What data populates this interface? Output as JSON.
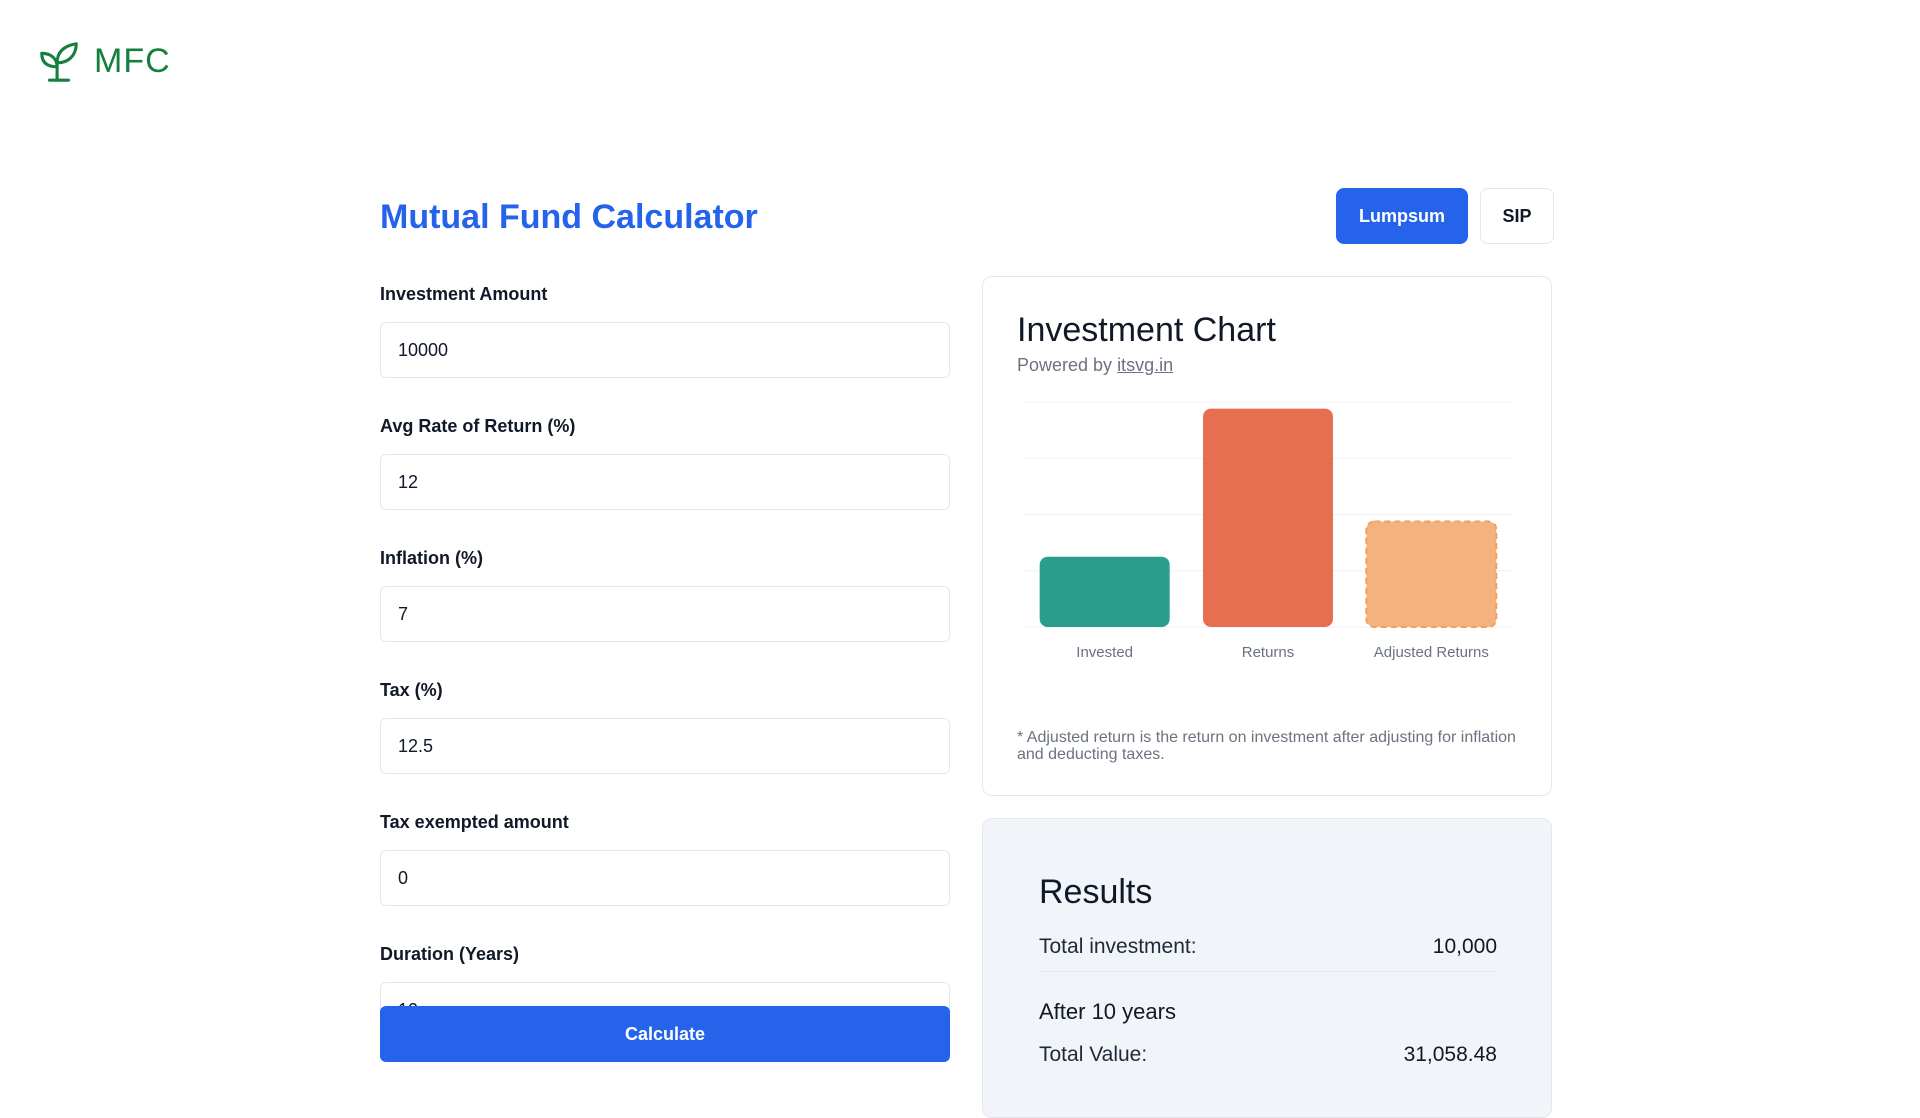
{
  "brand": {
    "logo_text": "MFC",
    "icon": "sprout-icon",
    "color": "#15803d"
  },
  "page": {
    "title": "Mutual Fund Calculator",
    "accent": "#2563eb"
  },
  "mode_toggle": {
    "active": "Lumpsum",
    "options": [
      "Lumpsum",
      "SIP"
    ]
  },
  "form": {
    "fields": [
      {
        "label": "Investment Amount",
        "value": "10000"
      },
      {
        "label": "Avg Rate of Return (%)",
        "value": "12"
      },
      {
        "label": "Inflation (%)",
        "value": "7"
      },
      {
        "label": "Tax (%)",
        "value": "12.5"
      },
      {
        "label": "Tax exempted amount",
        "value": "0"
      },
      {
        "label": "Duration (Years)",
        "value": "10"
      }
    ],
    "submit_label": "Calculate"
  },
  "chart_card": {
    "title": "Investment Chart",
    "powered_prefix": "Powered by ",
    "powered_link": "itsvg.in",
    "note": "* Adjusted return is the return on investment after adjusting for inflation and deducting taxes."
  },
  "chart_data": {
    "type": "bar",
    "categories": [
      "Invested",
      "Returns",
      "Adjusted Returns"
    ],
    "values": [
      10000,
      31058.48,
      15000
    ],
    "ylim": [
      0,
      32000
    ],
    "grid": true,
    "colors": [
      "#2a9d8f",
      "#e76f51",
      "#f4b37e"
    ],
    "title": "",
    "xlabel": "",
    "ylabel": ""
  },
  "results": {
    "title": "Results",
    "total_investment_label": "Total investment:",
    "total_investment_value": "10,000",
    "after_label": "After 10 years",
    "total_value_label": "Total Value:",
    "total_value_value": "31,058.48"
  }
}
